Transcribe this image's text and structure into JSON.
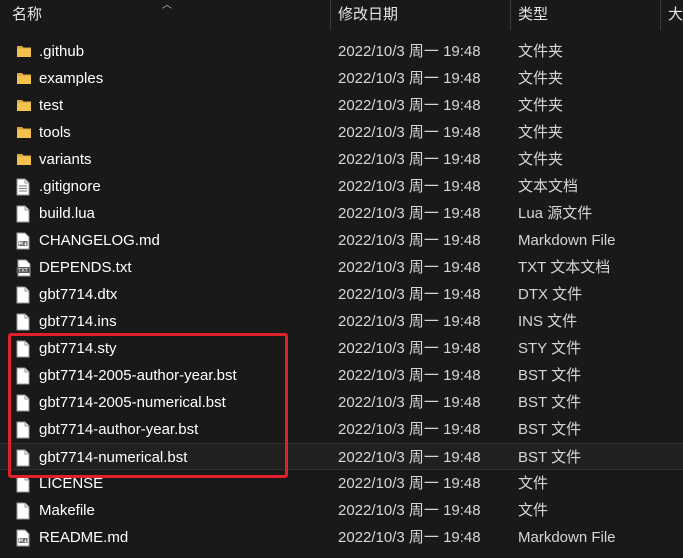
{
  "header": {
    "name_label": "名称",
    "date_label": "修改日期",
    "type_label": "类型",
    "size_label": "大"
  },
  "files": [
    {
      "name": ".github",
      "date": "2022/10/3 周一 19:48",
      "type": "文件夹",
      "icon": "folder-icon"
    },
    {
      "name": "examples",
      "date": "2022/10/3 周一 19:48",
      "type": "文件夹",
      "icon": "folder-icon"
    },
    {
      "name": "test",
      "date": "2022/10/3 周一 19:48",
      "type": "文件夹",
      "icon": "folder-icon"
    },
    {
      "name": "tools",
      "date": "2022/10/3 周一 19:48",
      "type": "文件夹",
      "icon": "folder-icon"
    },
    {
      "name": "variants",
      "date": "2022/10/3 周一 19:48",
      "type": "文件夹",
      "icon": "folder-icon"
    },
    {
      "name": ".gitignore",
      "date": "2022/10/3 周一 19:48",
      "type": "文本文档",
      "icon": "text-document-icon"
    },
    {
      "name": "build.lua",
      "date": "2022/10/3 周一 19:48",
      "type": "Lua 源文件",
      "icon": "file-icon"
    },
    {
      "name": "CHANGELOG.md",
      "date": "2022/10/3 周一 19:48",
      "type": "Markdown File",
      "icon": "markdown-file-icon"
    },
    {
      "name": "DEPENDS.txt",
      "date": "2022/10/3 周一 19:48",
      "type": "TXT 文本文档",
      "icon": "txt-file-icon"
    },
    {
      "name": "gbt7714.dtx",
      "date": "2022/10/3 周一 19:48",
      "type": "DTX 文件",
      "icon": "file-icon"
    },
    {
      "name": "gbt7714.ins",
      "date": "2022/10/3 周一 19:48",
      "type": "INS 文件",
      "icon": "file-icon"
    },
    {
      "name": "gbt7714.sty",
      "date": "2022/10/3 周一 19:48",
      "type": "STY 文件",
      "icon": "file-icon"
    },
    {
      "name": "gbt7714-2005-author-year.bst",
      "date": "2022/10/3 周一 19:48",
      "type": "BST 文件",
      "icon": "file-icon"
    },
    {
      "name": "gbt7714-2005-numerical.bst",
      "date": "2022/10/3 周一 19:48",
      "type": "BST 文件",
      "icon": "file-icon"
    },
    {
      "name": "gbt7714-author-year.bst",
      "date": "2022/10/3 周一 19:48",
      "type": "BST 文件",
      "icon": "file-icon"
    },
    {
      "name": "gbt7714-numerical.bst",
      "date": "2022/10/3 周一 19:48",
      "type": "BST 文件",
      "icon": "file-icon"
    },
    {
      "name": "LICENSE",
      "date": "2022/10/3 周一 19:48",
      "type": "文件",
      "icon": "file-icon"
    },
    {
      "name": "Makefile",
      "date": "2022/10/3 周一 19:48",
      "type": "文件",
      "icon": "file-icon"
    },
    {
      "name": "README.md",
      "date": "2022/10/3 周一 19:48",
      "type": "Markdown File",
      "icon": "markdown-file-icon"
    }
  ],
  "colors": {
    "background": "#191919",
    "folder": "#f2c14e",
    "highlight_border": "#e0202a"
  }
}
